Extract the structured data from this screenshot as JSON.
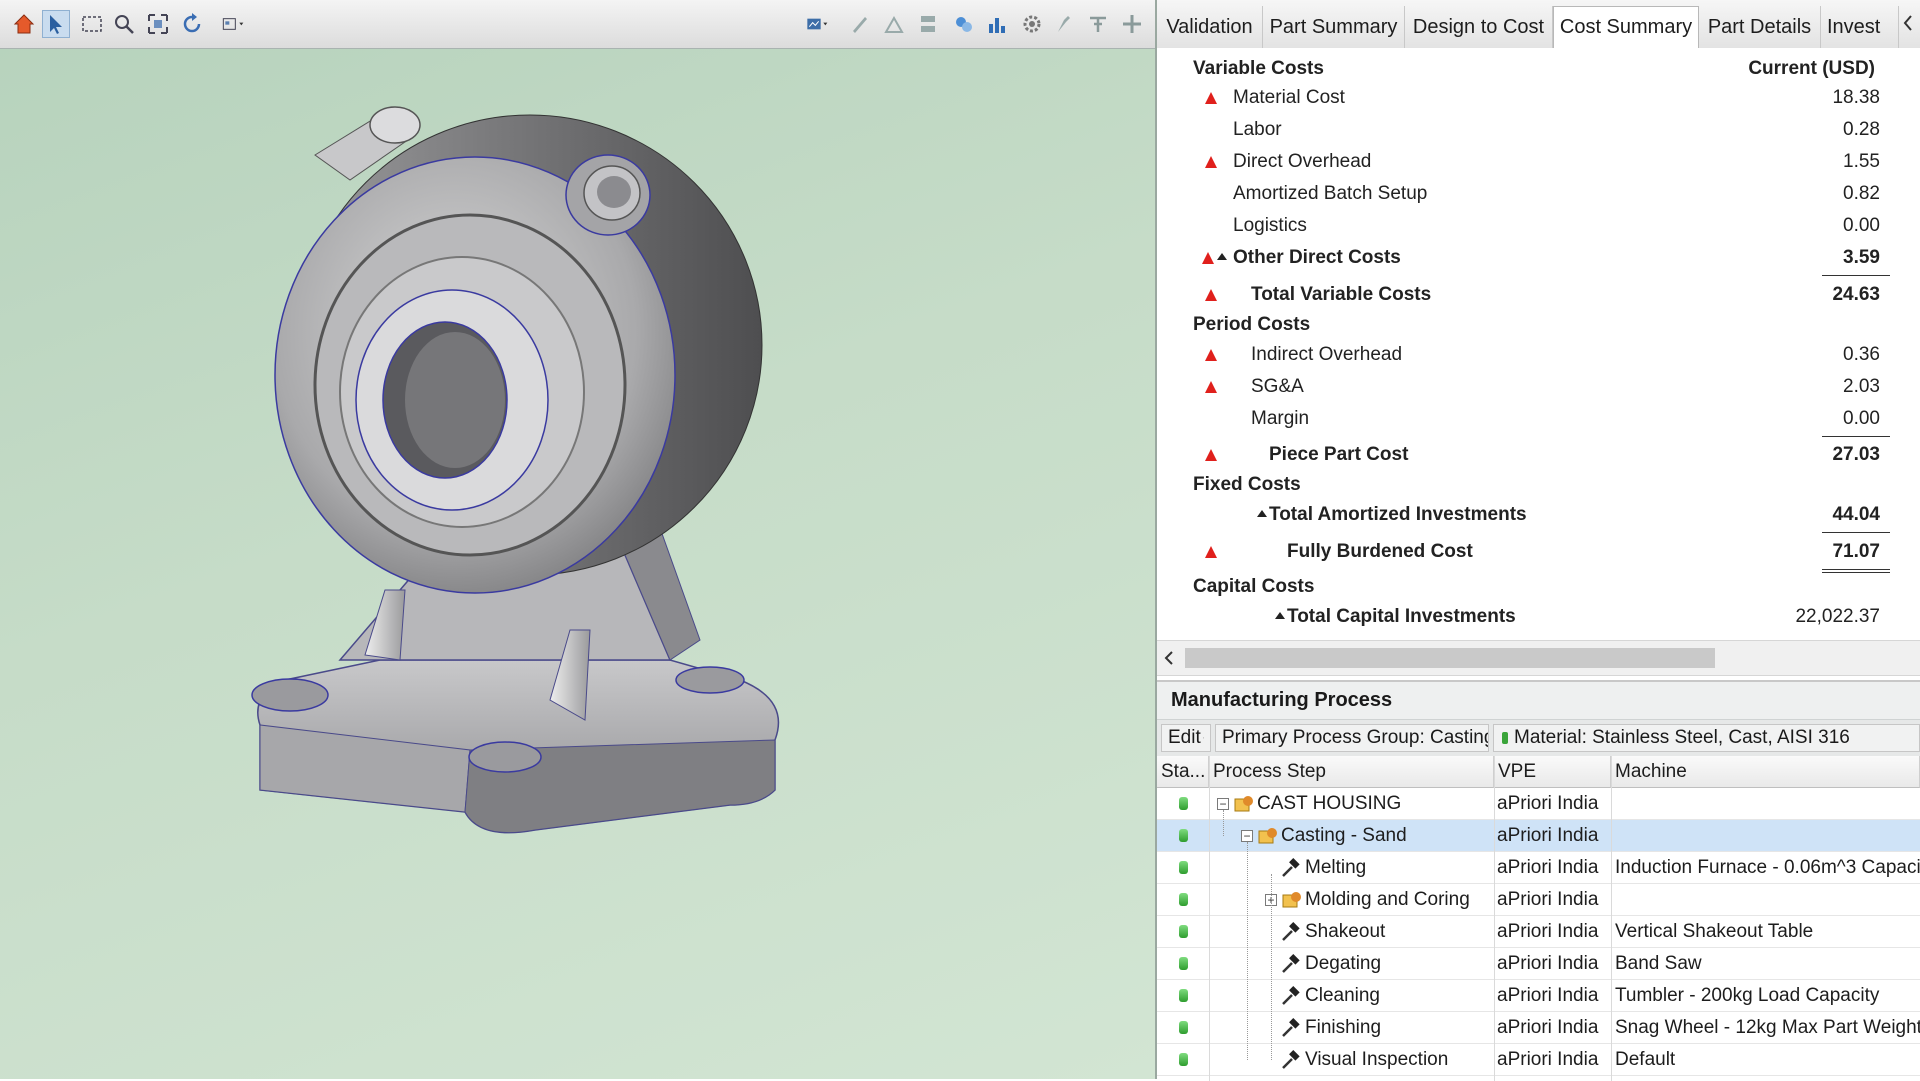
{
  "viewport": {
    "toolbar_left_icons": [
      "home-icon",
      "select-arrow-icon",
      "box-select-icon",
      "zoom-icon",
      "fit-view-icon",
      "rotate-icon",
      "view-options-icon"
    ],
    "toolbar_right_icons": [
      "display-mode-icon",
      "sketch-icon",
      "draft-icon",
      "section-icon",
      "features-icon",
      "chart-icon",
      "settings-icon",
      "pin-icon",
      "tools-icon",
      "dock-icon"
    ]
  },
  "tabs": [
    "Validation",
    "Part Summary",
    "Design to Cost",
    "Cost Summary",
    "Part Details",
    "Invest"
  ],
  "active_tab": "Cost Summary",
  "cost_summary": {
    "header_label": "Variable Costs",
    "header_value": "Current (USD)",
    "rows": [
      {
        "label": "Material Cost",
        "value": "18.38"
      },
      {
        "label": "Labor",
        "value": "0.28"
      },
      {
        "label": "Direct Overhead",
        "value": "1.55"
      },
      {
        "label": "Amortized Batch Setup",
        "value": "0.82"
      },
      {
        "label": "Logistics",
        "value": "0.00"
      },
      {
        "label": "Other Direct Costs",
        "value": "3.59"
      },
      {
        "label": "Total Variable Costs",
        "value": "24.63"
      },
      {
        "label": "Period Costs",
        "value": ""
      },
      {
        "label": "Indirect Overhead",
        "value": "0.36"
      },
      {
        "label": "SG&A",
        "value": "2.03"
      },
      {
        "label": "Margin",
        "value": "0.00"
      },
      {
        "label": "Piece Part Cost",
        "value": "27.03"
      },
      {
        "label": "Fixed Costs",
        "value": ""
      },
      {
        "label": "Total Amortized Investments",
        "value": "44.04"
      },
      {
        "label": "Fully Burdened Cost",
        "value": "71.07"
      },
      {
        "label": "Capital Costs",
        "value": ""
      },
      {
        "label": "Total Capital Investments",
        "value": "22,022.37"
      }
    ]
  },
  "manufacturing": {
    "title": "Manufacturing Process",
    "edit_label": "Edit",
    "process_group": "Primary Process Group: Casting - Sand",
    "material": "Material: Stainless Steel, Cast, AISI 316",
    "columns": [
      "Sta...",
      "Process Step",
      "VPE",
      "Machine"
    ],
    "rows": [
      {
        "step": "CAST HOUSING",
        "vpe": "aPriori India",
        "machine": ""
      },
      {
        "step": "Casting - Sand",
        "vpe": "aPriori India",
        "machine": ""
      },
      {
        "step": "Melting",
        "vpe": "aPriori India",
        "machine": "Induction Furnace - 0.06m^3 Capaci"
      },
      {
        "step": "Molding and Coring",
        "vpe": "aPriori India",
        "machine": ""
      },
      {
        "step": "Shakeout",
        "vpe": "aPriori India",
        "machine": "Vertical Shakeout Table"
      },
      {
        "step": "Degating",
        "vpe": "aPriori India",
        "machine": "Band Saw"
      },
      {
        "step": "Cleaning",
        "vpe": "aPriori India",
        "machine": "Tumbler - 200kg Load Capacity"
      },
      {
        "step": "Finishing",
        "vpe": "aPriori India",
        "machine": "Snag Wheel - 12kg Max Part Weight"
      },
      {
        "step": "Visual Inspection",
        "vpe": "aPriori India",
        "machine": "Default"
      }
    ]
  },
  "colors": {
    "warning": "#e0201c",
    "selection": "#cfe3f7",
    "status_ok": "#2f9d2f"
  }
}
